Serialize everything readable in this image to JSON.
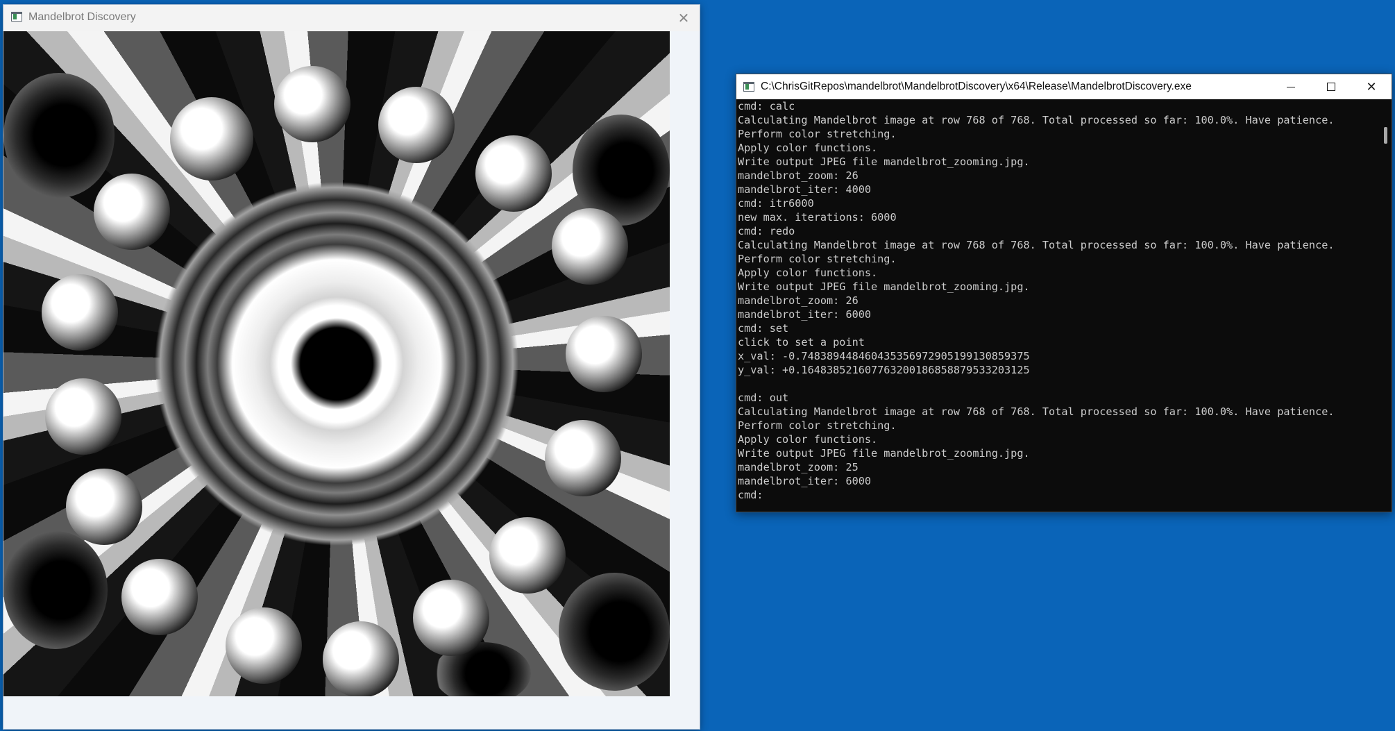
{
  "desktop": {
    "background": "#0a64b8"
  },
  "mandelbrot_window": {
    "title": "Mandelbrot Discovery",
    "app_icon": "window-app-icon",
    "close_icon": "close-icon",
    "canvas_icon": "mandelbrot-fractal-image"
  },
  "console_window": {
    "title": "C:\\ChrisGitRepos\\mandelbrot\\MandelbrotDiscovery\\x64\\Release\\MandelbrotDiscovery.exe",
    "minimize_icon": "minimize-icon",
    "maximize_icon": "maximize-icon",
    "close_icon": "close-icon",
    "lines": [
      "cmd: calc",
      "Calculating Mandelbrot image at row 768 of 768. Total processed so far: 100.0%. Have patience.",
      "Perform color stretching.",
      "Apply color functions.",
      "Write output JPEG file mandelbrot_zooming.jpg.",
      "mandelbrot_zoom: 26",
      "mandelbrot_iter: 4000",
      "cmd: itr6000",
      "new max. iterations: 6000",
      "cmd: redo",
      "Calculating Mandelbrot image at row 768 of 768. Total processed so far: 100.0%. Have patience.",
      "Perform color stretching.",
      "Apply color functions.",
      "Write output JPEG file mandelbrot_zooming.jpg.",
      "mandelbrot_zoom: 26",
      "mandelbrot_iter: 6000",
      "cmd: set",
      "click to set a point",
      "x_val: -0.748389448460435356972905199130859375",
      "y_val: +0.164838521607763200186858879533203125",
      "",
      "cmd: out",
      "Calculating Mandelbrot image at row 768 of 768. Total processed so far: 100.0%. Have patience.",
      "Perform color stretching.",
      "Apply color functions.",
      "Write output JPEG file mandelbrot_zooming.jpg.",
      "mandelbrot_zoom: 25",
      "mandelbrot_iter: 6000",
      "cmd:"
    ]
  }
}
